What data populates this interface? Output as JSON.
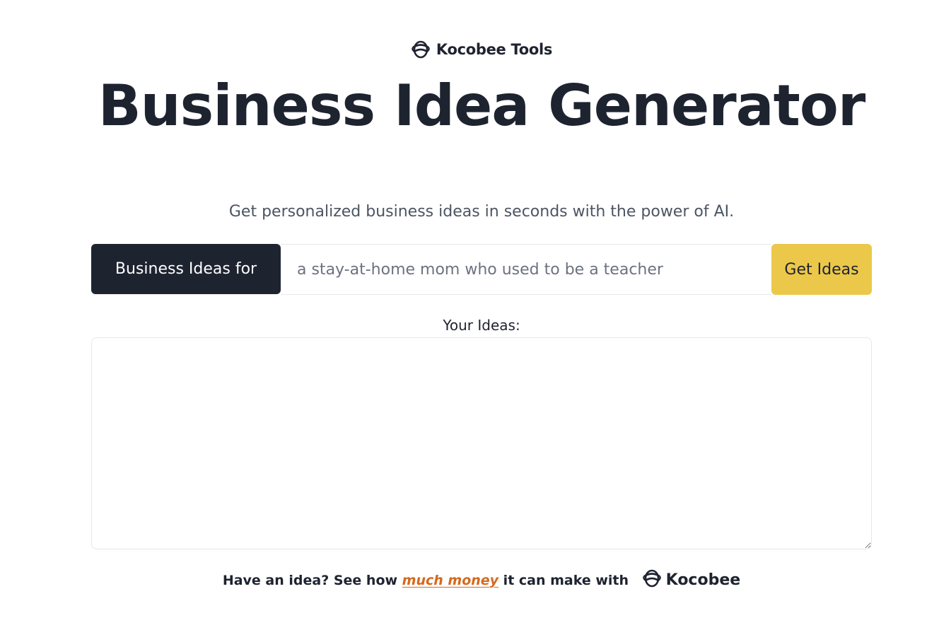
{
  "brand": {
    "name": "Kocobee Tools",
    "icon": "bee-icon"
  },
  "hero": {
    "title": "Business Idea Generator",
    "subtitle": "Get personalized business ideas in seconds with the power of AI."
  },
  "form": {
    "prefix_label": "Business Ideas for",
    "input_value": "",
    "input_placeholder": "a stay-at-home mom who used to be a teacher",
    "submit_label": "Get Ideas"
  },
  "results": {
    "label": "Your Ideas:",
    "value": ""
  },
  "footer": {
    "text_before": "Have an idea? See how ",
    "link_text": "much money",
    "text_after": " it can make with ",
    "brand_name": "Kocobee",
    "brand_icon": "bee-icon"
  },
  "colors": {
    "primary_dark": "#1e2330",
    "accent_yellow": "#ebc84a",
    "link_orange": "#d4691f",
    "muted_text": "#4b5563"
  }
}
